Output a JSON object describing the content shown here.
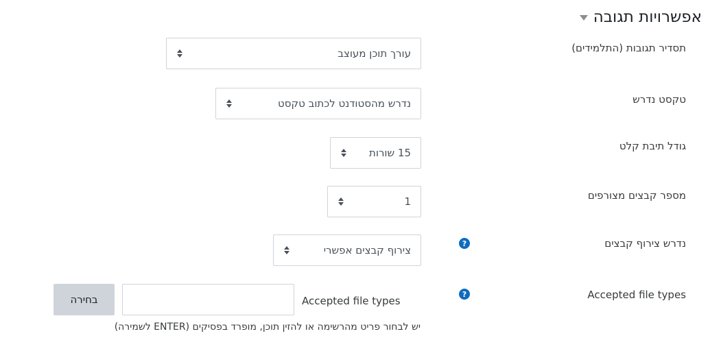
{
  "section": {
    "title": "אפשרויות תגובה",
    "toggle_icon": "caret-down-icon"
  },
  "rows": {
    "response_format": {
      "label": "תסדיר תגובות (התלמידים)",
      "value": "עורך תוכן מעוצב"
    },
    "require_text": {
      "label": "טקסט נדרש",
      "value": "נדרש מהסטודנט לכתוב טקסט"
    },
    "input_box_size": {
      "label": "גודל תיבת קלט",
      "value": "15 שורות"
    },
    "attachments_count": {
      "label": "מספר קבצים מצורפים",
      "value": "1"
    },
    "attachments_required": {
      "label": "נדרש צירוף קבצים",
      "value": "צירוף קבצים אפשרי",
      "help_icon": "question-circle-icon"
    },
    "accepted_file_types": {
      "label": "Accepted file types",
      "inline_label": "Accepted file types",
      "input_value": "",
      "choose_button": "בחירה",
      "hint": "יש לבחור פריט מהרשימה או להזין תוכן, מופרד בפסיקים (ENTER לשמירה)",
      "help_icon": "question-circle-icon"
    }
  },
  "colors": {
    "help_icon_bg": "#0f6cbf",
    "border": "#ced4da",
    "button_bg": "#ced4da",
    "text": "#373a3c"
  }
}
